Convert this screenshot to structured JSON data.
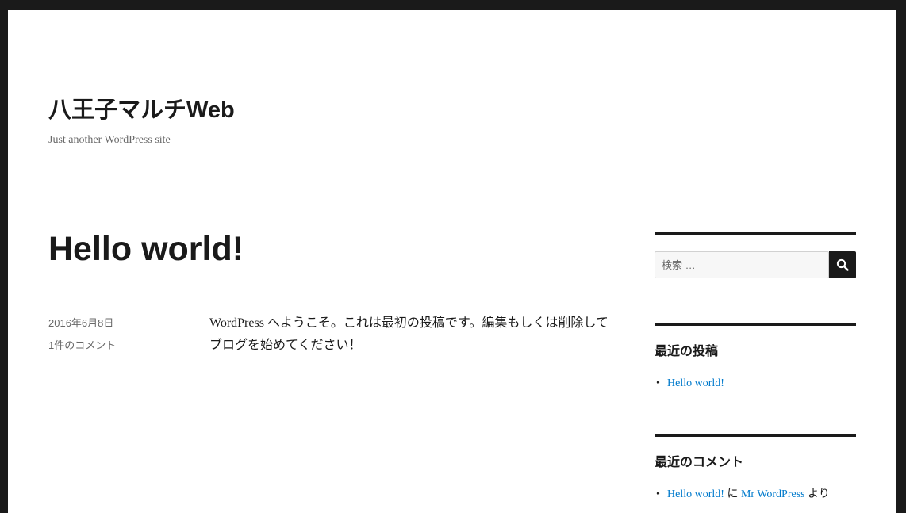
{
  "site": {
    "title": "八王子マルチWeb",
    "description": "Just another WordPress site"
  },
  "post": {
    "title": "Hello world!",
    "date": "2016年6月8日",
    "comments_link": "1件のコメント",
    "content": "WordPress へようこそ。これは最初の投稿です。編集もしくは削除してブログを始めてください！"
  },
  "sidebar": {
    "search": {
      "placeholder": "検索 …",
      "button_icon": "search-icon"
    },
    "recent_posts": {
      "title": "最近の投稿",
      "items": [
        {
          "label": "Hello world!"
        }
      ]
    },
    "recent_comments": {
      "title": "最近のコメント",
      "items": [
        {
          "post": "Hello world!",
          "joiner": "に",
          "author": "Mr WordPress",
          "suffix": "より"
        }
      ]
    }
  },
  "colors": {
    "frame": "#1a1a1a",
    "text": "#1a1a1a",
    "secondary_text": "#686868",
    "link": "#007acc",
    "background": "#ffffff"
  }
}
